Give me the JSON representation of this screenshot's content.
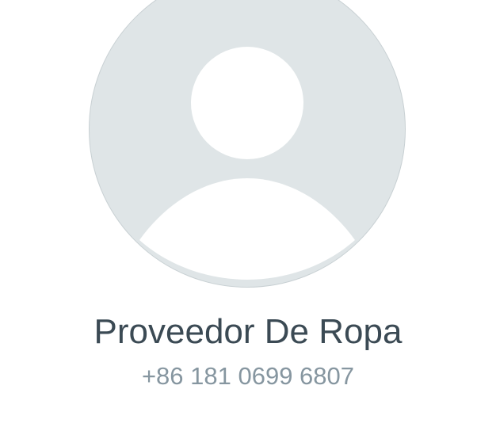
{
  "contact": {
    "name": "Proveedor De Ropa",
    "phone": "+86 181 0699 6807"
  },
  "avatar": {
    "icon": "default-user-avatar-icon",
    "background_color": "#dfe5e7",
    "figure_color": "#ffffff"
  },
  "colors": {
    "name_text": "#3b4a54",
    "phone_text": "#8696a0"
  }
}
